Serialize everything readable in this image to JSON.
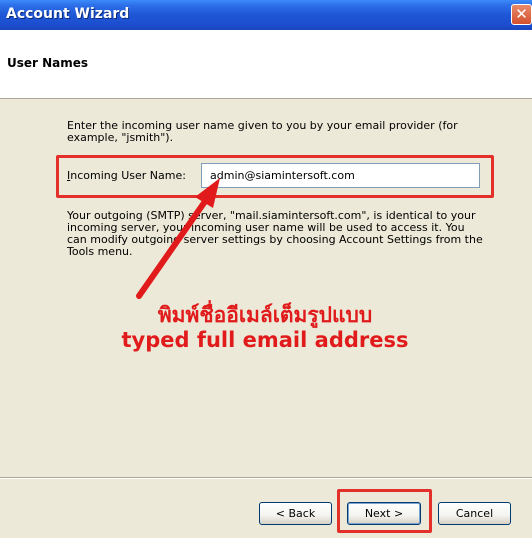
{
  "window": {
    "title": "Account Wizard",
    "close_glyph": "✕"
  },
  "header": {
    "title": "User Names"
  },
  "main": {
    "intro_text": "Enter the incoming user name given to you by your email provider (for example, \"jsmith\").",
    "incoming_label": "Incoming User Name:",
    "incoming_value": "admin@siamintersoft.com",
    "outgoing_text": "Your outgoing (SMTP) server, \"mail.siamintersoft.com\", is identical to your incoming server, your incoming user name will be used to access it. You can modify outgoing server settings by choosing Account Settings from the Tools menu."
  },
  "annotation": {
    "thai": "พิมพ์ชื่ออีเมล์เต็มรูปแบบ",
    "english": "typed full email address",
    "color": "#E11B1B"
  },
  "buttons": {
    "back": "< Back",
    "next": "Next >",
    "cancel": "Cancel"
  },
  "colors": {
    "highlight_box": "#E4302B",
    "titlebar": "#1F56D6"
  }
}
